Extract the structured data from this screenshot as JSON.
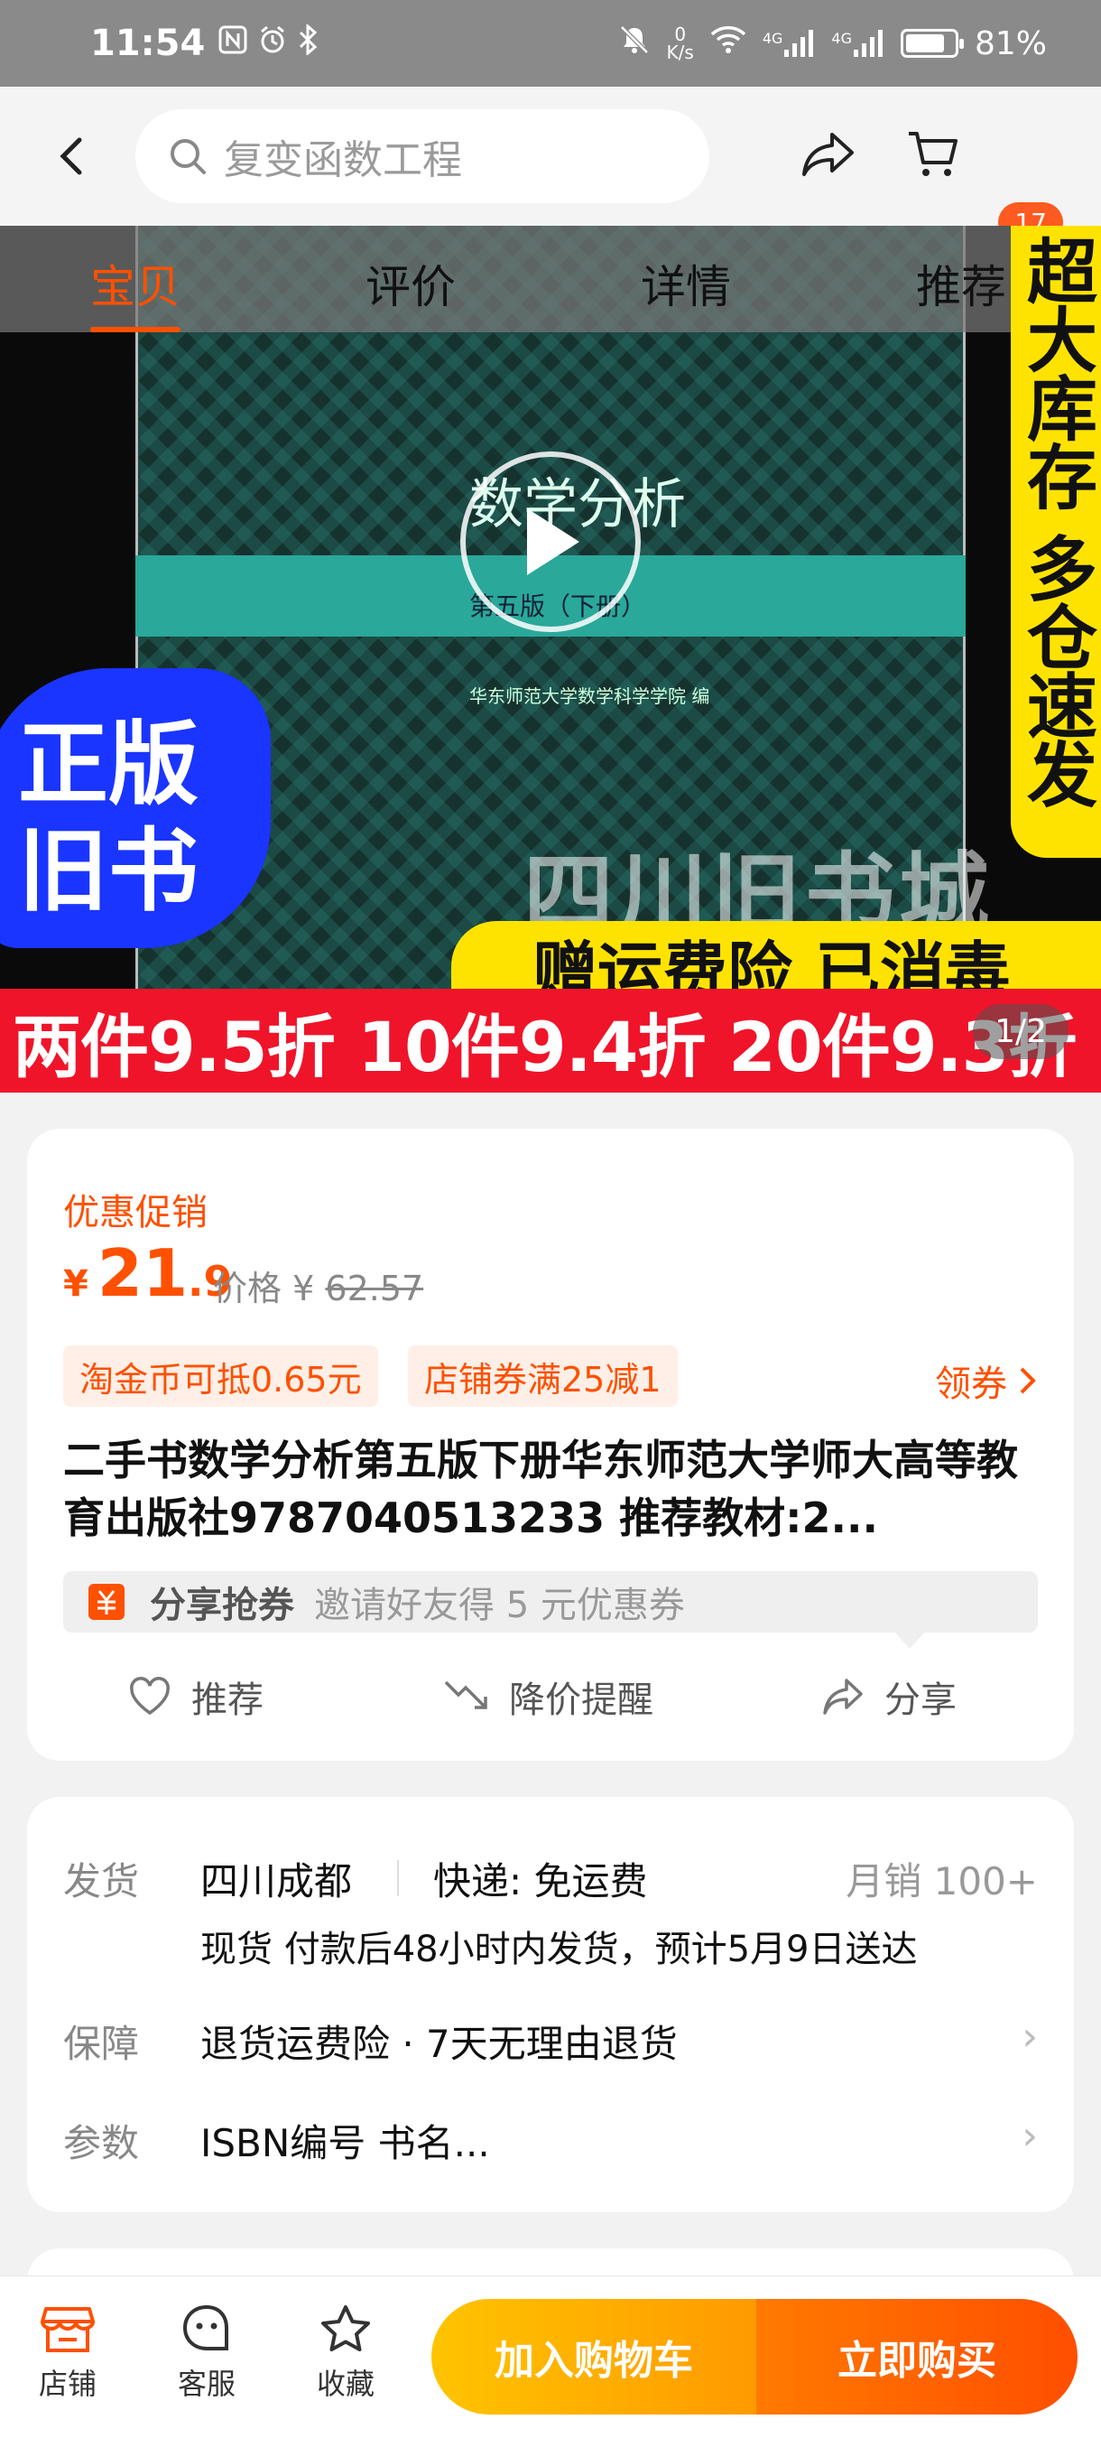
{
  "status_bar": {
    "time": "11:54",
    "net_speed_value": "0",
    "net_speed_unit": "K/s",
    "signal1": "4G",
    "signal2": "4G",
    "battery": "81%",
    "battery_level": 0.81
  },
  "nav": {
    "search_placeholder": "复变函数工程",
    "cart_badge": "17"
  },
  "tabs": [
    "宝贝",
    "评价",
    "详情",
    "推荐"
  ],
  "hero": {
    "book_title": "数学分析",
    "book_edition": "第五版（下册）",
    "book_publisher": "华东师范大学数学科学学院 编",
    "store_watermark": "四川旧书城",
    "side_banner": "超大库存 多仓速发",
    "badge_line1": "正版",
    "badge_line2": "旧书",
    "yellow_strip": "赠运费险 已消毒",
    "red_strip": "两件9.5折 10件9.4折 20件9.3折",
    "counter": "1/2"
  },
  "price_card": {
    "promo_label": "优惠促销",
    "currency": "¥",
    "price_int": "21",
    "price_dec": ".9",
    "orig_label": "价格",
    "orig_currency": "¥",
    "orig_value": "62.57",
    "coupon1": "淘金币可抵0.65元",
    "coupon2": "店铺券满25减1",
    "get_coupon": "领券",
    "title": "二手书数学分析第五版下册华东师范大学师大高等教育出版社9787040513233 推荐教材:2...",
    "share_bold": "分享抢券",
    "share_light": "邀请好友得 5 元优惠券",
    "actions": {
      "recommend": "推荐",
      "price_alert": "降价提醒",
      "share": "分享"
    }
  },
  "info_card": {
    "ship_label": "发货",
    "ship_from": "四川成都",
    "express": "快递:  免运费",
    "monthly_sales": "月销  100+",
    "ship_detail": "现货 付款后48小时内发货，预计5月9日送达",
    "guarantee_label": "保障",
    "guarantee": "退货运费险 · 7天无理由退货",
    "params_label": "参数",
    "params": "ISBN编号 书名..."
  },
  "bottom_bar": {
    "shop": "店铺",
    "service": "客服",
    "favorite": "收藏",
    "add_cart": "加入购物车",
    "buy_now": "立即购买"
  },
  "colors": {
    "accent": "#ff5000",
    "cart_btn": "#ffb000",
    "buy_btn": "#ff5a00",
    "promo_red": "#f0142a",
    "banner_yellow": "#ffe300",
    "badge_blue": "#1a35ff"
  }
}
